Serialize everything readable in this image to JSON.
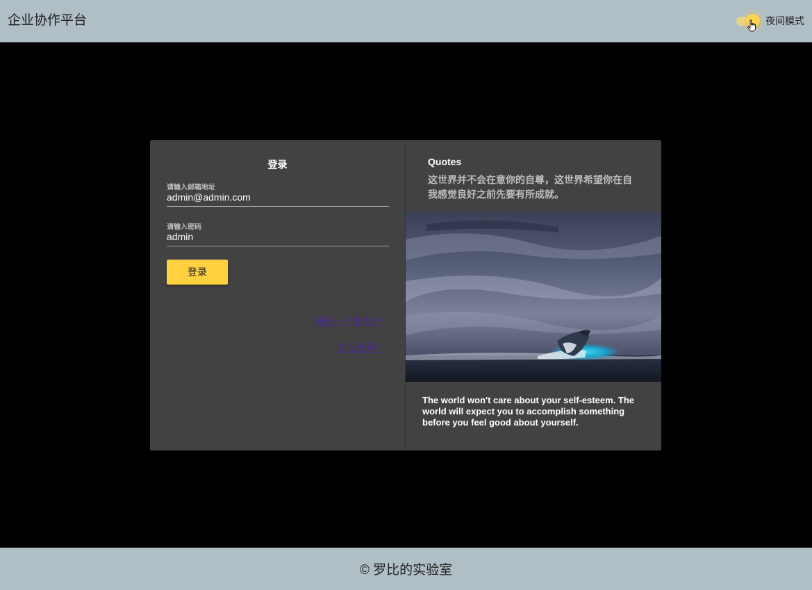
{
  "header": {
    "app_title": "企业协作平台",
    "night_mode_label": "夜间模式",
    "night_mode_on": true
  },
  "login": {
    "title": "登录",
    "email_label": "请输入邮箱地址",
    "email_value": "admin@admin.com",
    "password_label": "请输入密码",
    "password_value": "admin",
    "submit_label": "登录",
    "create_account_link": "创建一个新账户",
    "forgot_password_link": "忘记密码?"
  },
  "quote": {
    "heading": "Quotes",
    "text_cn": "这世界并不会在意你的自尊，这世界希望你在自我感觉良好之前先要有所成就。",
    "text_en": "The world won't care about your self-esteem. The world will expect you to accomplish something before you feel good about yourself.",
    "image": "whale-breaching-stormy-sea"
  },
  "footer": {
    "text": "© 罗比的实验室"
  },
  "colors": {
    "bar_background": "#b0bec5",
    "page_background": "#000000",
    "card_background": "#424242",
    "accent": "#ffd040",
    "link": "#4a2a8a"
  }
}
